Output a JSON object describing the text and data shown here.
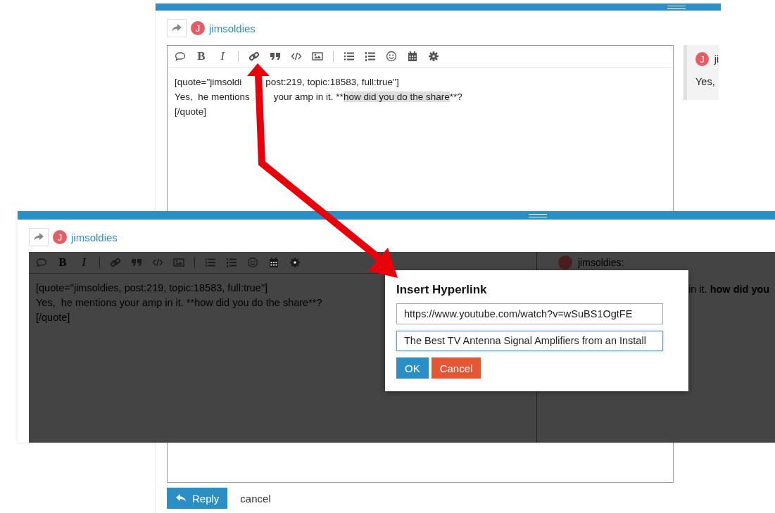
{
  "back": {
    "user": {
      "initial": "J",
      "name": "jimsoldies"
    },
    "toolbar": [
      {
        "kind": "bubble"
      },
      {
        "kind": "bold",
        "label": "B"
      },
      {
        "kind": "italic",
        "label": "I"
      },
      {
        "kind": "sep"
      },
      {
        "kind": "link"
      },
      {
        "kind": "quote"
      },
      {
        "kind": "code"
      },
      {
        "kind": "image"
      },
      {
        "kind": "sep"
      },
      {
        "kind": "bullets"
      },
      {
        "kind": "numbers"
      },
      {
        "kind": "emoji"
      },
      {
        "kind": "calendar"
      },
      {
        "kind": "gear"
      }
    ],
    "lines": [
      {
        "text": "[quote=\"jimsoldi",
        "rest": "post:219, topic:18583, full:true\"]"
      },
      {
        "text": "Yes,  he mentions",
        "rest": "your amp in it. **",
        "highlight": "how did you do the share",
        "after": "**?"
      },
      {
        "text": "[/quote]"
      }
    ],
    "preview": {
      "initial": "J",
      "name": "ji",
      "text": "Yes,"
    },
    "reply_button": "Reply",
    "cancel_link": "cancel"
  },
  "front": {
    "user": {
      "initial": "J",
      "name": "jimsoldies"
    },
    "toolbar": [
      {
        "kind": "bubble"
      },
      {
        "kind": "bold",
        "label": "B"
      },
      {
        "kind": "italic",
        "label": "I"
      },
      {
        "kind": "sep"
      },
      {
        "kind": "link"
      },
      {
        "kind": "quote"
      },
      {
        "kind": "code"
      },
      {
        "kind": "image"
      },
      {
        "kind": "sep"
      },
      {
        "kind": "bullets"
      },
      {
        "kind": "numbers"
      },
      {
        "kind": "emoji"
      },
      {
        "kind": "calendar"
      },
      {
        "kind": "gear"
      }
    ],
    "lines": [
      {
        "text": "[quote=\"jimsoldies, post:219, topic:18583, full:true\"]"
      },
      {
        "text": "Yes,  he mentions your amp in it. **how did you do the share**?"
      },
      {
        "text": "[/quote]"
      }
    ],
    "preview": {
      "name": "jimsoldies:",
      "text": "in it. **how did you**"
    }
  },
  "dialog": {
    "title": "Insert Hyperlink",
    "url": "https://www.youtube.com/watch?v=wSuBS1OgtFE",
    "link_text": "The Best TV Antenna Signal Amplifiers from an Install",
    "ok": "OK",
    "cancel": "Cancel"
  }
}
